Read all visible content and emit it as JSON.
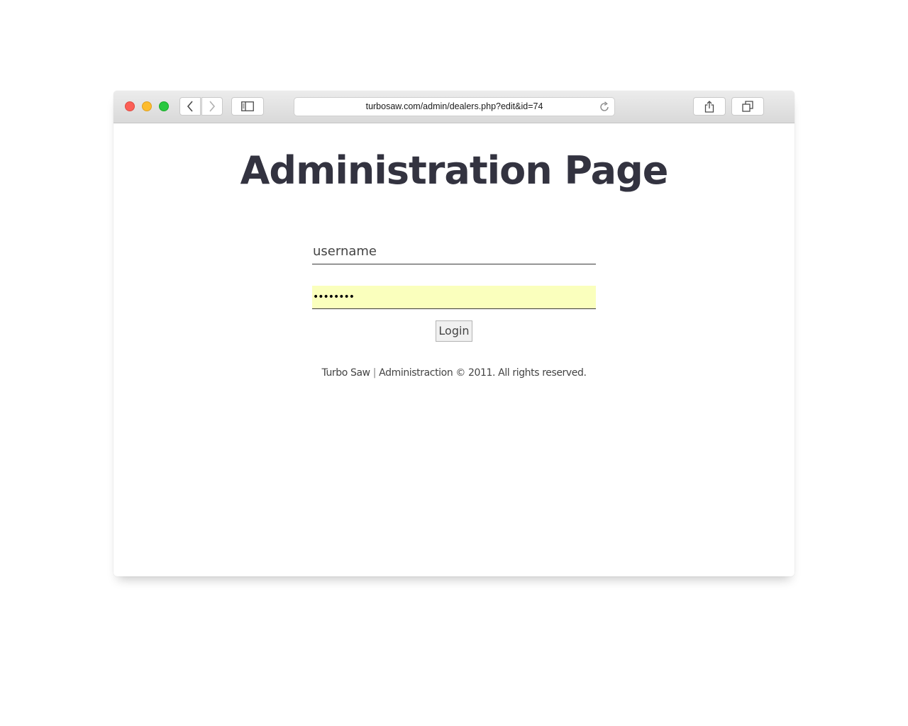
{
  "browser": {
    "url": "turbosaw.com/admin/dealers.php?edit&id=74",
    "traffic_lights": {
      "close_color": "#fc5f57",
      "minimize_color": "#fdbc2e",
      "zoom_color": "#29c840"
    },
    "icons": {
      "back": "chevron-left-icon",
      "forward": "chevron-right-icon",
      "sidebar": "sidebar-icon",
      "reload": "reload-icon",
      "share": "share-icon",
      "tabs": "tabs-overview-icon"
    }
  },
  "page": {
    "title": "Administration Page",
    "title_color": "#333340",
    "login_form": {
      "username_placeholder": "username",
      "username_value": "",
      "password_value": "••••••••",
      "password_autofill_color": "#faffbd",
      "login_label": "Login"
    },
    "footer": {
      "brand": "Turbo Saw",
      "separator": "|",
      "text": "Administraction © 2011. All rights reserved."
    }
  }
}
